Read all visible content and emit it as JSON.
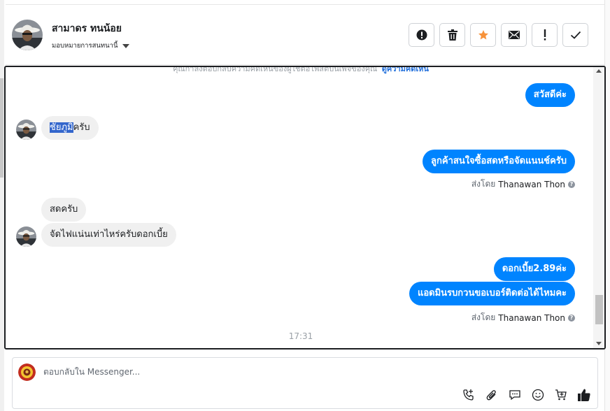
{
  "header": {
    "contact_name": "สามาดร ทนน้อย",
    "assign_label": "มอบหมายการสนทนานี้",
    "actions": [
      {
        "name": "spam-button",
        "icon": "alert-circle-icon"
      },
      {
        "name": "delete-button",
        "icon": "trash-icon"
      },
      {
        "name": "star-button",
        "icon": "star-icon"
      },
      {
        "name": "mark-unread-button",
        "icon": "envelope-icon"
      },
      {
        "name": "follow-up-button",
        "icon": "exclamation-icon"
      },
      {
        "name": "mark-done-button",
        "icon": "checkmark-icon"
      }
    ]
  },
  "conversation": {
    "notice_text": "คุณกำลังตอบกลับความคิดเห็นของผู้ใช้ต่อโพสต์บนเพจของคุณ",
    "notice_link": "ดูความคิดเห็น",
    "messages": [
      {
        "dir": "out",
        "text": "สวัสดีค่ะ"
      },
      {
        "dir": "in",
        "highlight": "ชัยภูมิ",
        "text": "ครับ"
      },
      {
        "dir": "out",
        "text": "ลูกค้าสนใจซื้อสดหรือจัดแนนช์ครับ"
      },
      {
        "sent_by_label": "ส่งโดย",
        "sender": "Thanawan Thon"
      },
      {
        "dir": "in",
        "text": "สดครับ"
      },
      {
        "dir": "in",
        "text": "จัดไฟแน่นเท่าไหร่ครับดอกเบี้ย"
      },
      {
        "dir": "out",
        "text": "ดอกเบี้ย2.89ค่ะ"
      },
      {
        "dir": "out",
        "text": "แอดมินรบกวนขอเบอร์ติดต่อได้ไหมคะ"
      },
      {
        "sent_by_label": "ส่งโดย",
        "sender": "Thanawan Thon"
      }
    ],
    "timestamp": "17:31"
  },
  "composer": {
    "placeholder": "ตอบกลับใน Messenger...",
    "tools": [
      "phone-add-icon",
      "paperclip-icon",
      "saved-reply-icon",
      "emoji-icon",
      "cart-icon",
      "thumbs-up-icon"
    ]
  },
  "colors": {
    "outgoing_bubble": "#0084ff",
    "incoming_bubble": "#f0f0f0",
    "star": "#f7923a",
    "link": "#216fdb"
  }
}
